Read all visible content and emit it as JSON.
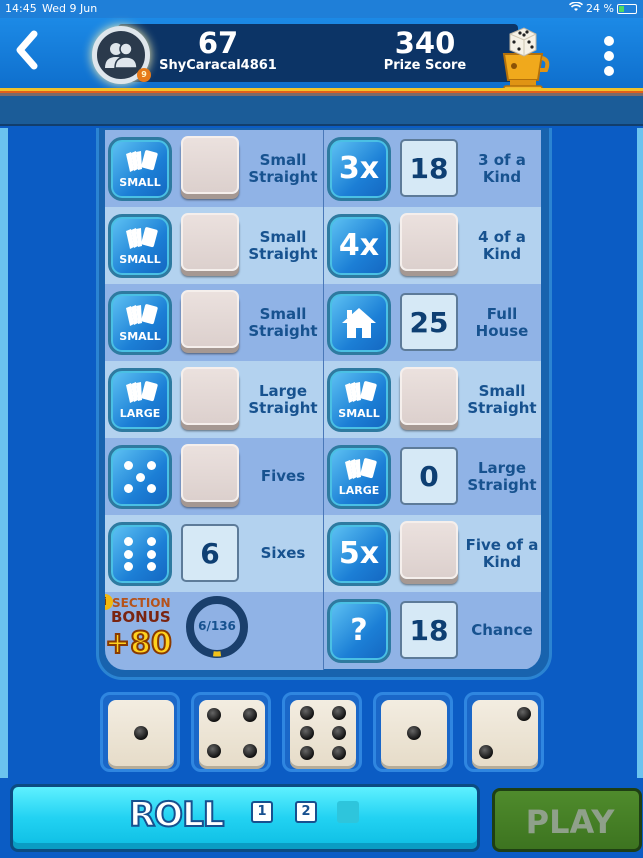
{
  "status_bar": {
    "time": "14:45",
    "date": "Wed 9 Jun",
    "wifi_icon": "wifi-icon",
    "battery": "24 %"
  },
  "header": {
    "back_icon": "chevron-left-icon",
    "player_score": "67",
    "player_name": "ShyCaracal4861",
    "player_level_badge": "9",
    "prize_score": "340",
    "prize_label": "Prize Score",
    "menu_icon": "vertical-dots-icon"
  },
  "upper_section": [
    {
      "icon": "small-straight-icon",
      "icon_text": "SMALL",
      "score": "",
      "label": "Small Straight"
    },
    {
      "icon": "small-straight-icon",
      "icon_text": "SMALL",
      "score": "",
      "label": "Small Straight"
    },
    {
      "icon": "small-straight-icon",
      "icon_text": "SMALL",
      "score": "",
      "label": "Small Straight"
    },
    {
      "icon": "large-straight-icon",
      "icon_text": "LARGE",
      "score": "",
      "label": "Large Straight"
    },
    {
      "icon": "die-five-icon",
      "icon_text": "",
      "score": "",
      "label": "Fives"
    },
    {
      "icon": "die-six-icon",
      "icon_text": "",
      "score": "6",
      "label": "Sixes"
    }
  ],
  "lower_section": [
    {
      "icon": "three-of-kind-icon",
      "icon_text": "3x",
      "score": "18",
      "label": "3 of a Kind"
    },
    {
      "icon": "four-of-kind-icon",
      "icon_text": "4x",
      "score": "",
      "label": "4 of a Kind"
    },
    {
      "icon": "house-icon",
      "icon_text": "",
      "score": "25",
      "label": "Full House"
    },
    {
      "icon": "small-straight-icon",
      "icon_text": "SMALL",
      "score": "",
      "label": "Small Straight"
    },
    {
      "icon": "large-straight-icon",
      "icon_text": "LARGE",
      "score": "0",
      "label": "Large Straight"
    },
    {
      "icon": "five-of-kind-icon",
      "icon_text": "5x",
      "score": "",
      "label": "Five of a Kind"
    },
    {
      "icon": "question-icon",
      "icon_text": "?",
      "score": "18",
      "label": "Chance"
    }
  ],
  "bonus": {
    "info_icon": "info-icon",
    "title_line1": "SECTION",
    "title_line2": "BONUS",
    "value": "+80",
    "progress_text": "6/136",
    "progress_fraction": 0.044
  },
  "dice": [
    1,
    4,
    6,
    1,
    2
  ],
  "actions": {
    "roll_label": "ROLL",
    "roll_counts": [
      "1",
      "2",
      ""
    ],
    "play_label": "PLAY"
  }
}
